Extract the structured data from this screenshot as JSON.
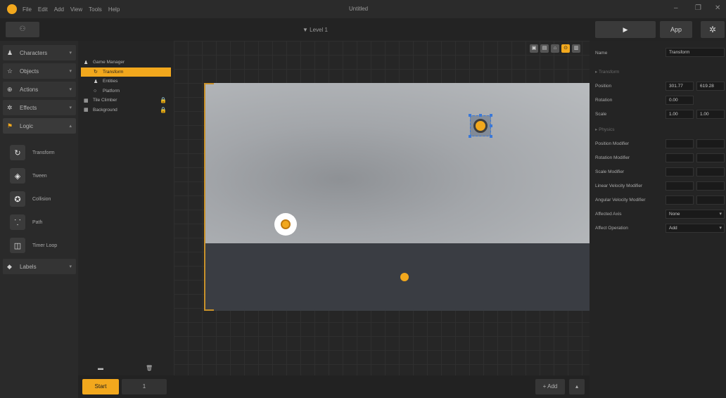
{
  "window": {
    "title": "Untitled",
    "menu": [
      "File",
      "Edit",
      "Add",
      "View",
      "Tools",
      "Help"
    ],
    "minimize": "–",
    "maximize": "❐",
    "close": "✕"
  },
  "toolbar": {
    "left_button_icon": "people-icon",
    "level_name": "▼ Level 1",
    "play_label": "▶",
    "app_label": "App",
    "settings_icon": "gear-icon"
  },
  "categories": [
    {
      "label": "Characters",
      "icon": "person-icon",
      "glyph": "♟"
    },
    {
      "label": "Objects",
      "icon": "star-icon",
      "glyph": "☆"
    },
    {
      "label": "Actions",
      "icon": "plus-circle-icon",
      "glyph": "⊕"
    },
    {
      "label": "Effects",
      "icon": "gear-icon",
      "glyph": "✲"
    },
    {
      "label": "Logic",
      "icon": "flag-icon",
      "glyph": "⚑"
    },
    {
      "label": "Labels",
      "icon": "tag-icon",
      "glyph": "◆"
    }
  ],
  "behaviors": [
    {
      "label": "Transform",
      "icon": "rotate-icon",
      "glyph": "↻"
    },
    {
      "label": "Tween",
      "icon": "target-icon",
      "glyph": "◈"
    },
    {
      "label": "Collision",
      "icon": "badge-icon",
      "glyph": "✪"
    },
    {
      "label": "Path",
      "icon": "path-icon",
      "glyph": "⸪"
    },
    {
      "label": "Timer Loop",
      "icon": "timer-icon",
      "glyph": "◫"
    }
  ],
  "hierarchy": {
    "header_icons": "👁 🔒",
    "nodes": [
      {
        "label": "Game Manager",
        "glyph": "♟",
        "indent": 0,
        "selected": false,
        "locked": false,
        "icon": "person-icon"
      },
      {
        "label": "Transform",
        "glyph": "↻",
        "indent": 1,
        "selected": true,
        "locked": false,
        "icon": "rotate-icon"
      },
      {
        "label": "Entities",
        "glyph": "♟",
        "indent": 1,
        "selected": false,
        "locked": false,
        "icon": "person-icon"
      },
      {
        "label": "Platform",
        "glyph": "○",
        "indent": 1,
        "selected": false,
        "locked": false,
        "icon": "circle-icon"
      },
      {
        "label": "Tile Climber",
        "glyph": "▦",
        "indent": 0,
        "selected": false,
        "locked": true,
        "icon": "grid-icon"
      },
      {
        "label": "Background",
        "glyph": "▦",
        "indent": 0,
        "selected": false,
        "locked": true,
        "icon": "grid-icon"
      }
    ],
    "footer_left": "▬",
    "footer_right": "🗑"
  },
  "viewport": {
    "tools": [
      {
        "glyph": "▣",
        "icon": "frame-icon",
        "active": false
      },
      {
        "glyph": "▤",
        "icon": "list-icon",
        "active": false
      },
      {
        "glyph": "⌂",
        "icon": "home-icon",
        "active": false
      },
      {
        "glyph": "⊙",
        "icon": "eye-icon",
        "active": true
      },
      {
        "glyph": "▥",
        "icon": "columns-icon",
        "active": false
      }
    ]
  },
  "bottombar": {
    "start_label": "Start",
    "count_label": "1",
    "add_label": "+ Add",
    "up_label": "▴"
  },
  "inspector": {
    "name_label": "Name",
    "name_value": "Transform",
    "section_transform": "▸ Transform",
    "rows": [
      {
        "label": "Position",
        "v1": "301.77",
        "v2": "619.28"
      },
      {
        "label": "Rotation",
        "v1": "0.00",
        "v2": ""
      },
      {
        "label": "Scale",
        "v1": "1.00",
        "v2": "1.00"
      }
    ],
    "section_physics": "▸ Physics",
    "physics_rows": [
      {
        "label": "Position Modifier",
        "v1": "",
        "v2": ""
      },
      {
        "label": "Rotation Modifier",
        "v1": "",
        "v2": ""
      },
      {
        "label": "Scale Modifier",
        "v1": "",
        "v2": ""
      },
      {
        "label": "Linear Velocity Modifier",
        "v1": "",
        "v2": ""
      },
      {
        "label": "Angular Velocity Modifier",
        "v1": "",
        "v2": ""
      }
    ],
    "selects": [
      {
        "label": "Affected Axis",
        "value": "None"
      },
      {
        "label": "Affect Operation",
        "value": "Add"
      }
    ]
  },
  "colors": {
    "accent": "#f2a81d",
    "background": "#1e1e1e",
    "panel": "#2a2a2a",
    "selection_outline": "#3a78d8"
  }
}
